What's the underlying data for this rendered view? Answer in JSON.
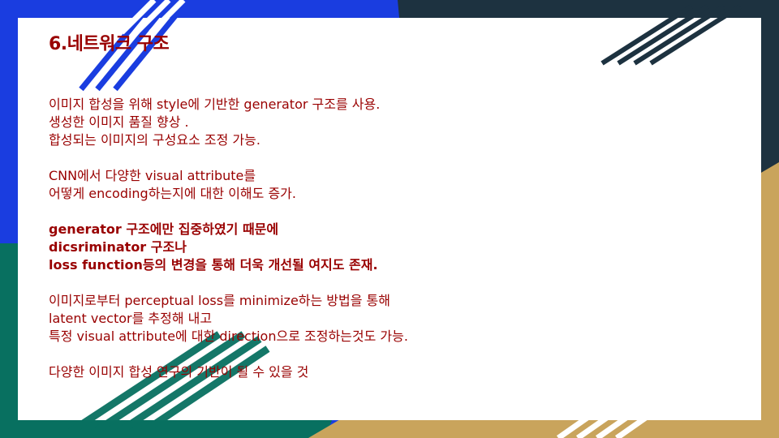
{
  "slide": {
    "title": "6.네트워크 구조",
    "paragraphs": [
      {
        "bold": false,
        "lines": [
          "이미지 합성을 위해 style에 기반한 generator 구조를 사용.",
          "생성한 이미지 품질 향상 .",
          "합성되는 이미지의 구성요소 조정 가능."
        ]
      },
      {
        "bold": false,
        "lines": [
          "CNN에서 다양한 visual attribute를",
          "어떻게 encoding하는지에 대한 이해도 증가."
        ]
      },
      {
        "bold": true,
        "lines": [
          "generator 구조에만 집중하였기 때문에",
          "dicsriminator 구조나",
          "loss function등의 변경을 통해 더욱 개선될 여지도 존재."
        ]
      },
      {
        "bold": false,
        "lines": [
          "이미지로부터 perceptual loss를 minimize하는 방법을 통해",
          "latent vector를 추정해 내고",
          "특정 visual attribute에 대한 direction으로 조정하는것도 가능."
        ]
      },
      {
        "bold": false,
        "lines": [
          "다양한 이미지 합성 연구의 기반이 될 수 있을 것"
        ]
      }
    ]
  },
  "colors": {
    "text": "#990000",
    "blue": "#1a3de0",
    "navy": "#1d3240",
    "green": "#087060",
    "gold": "#c9a45c",
    "white": "#ffffff"
  }
}
